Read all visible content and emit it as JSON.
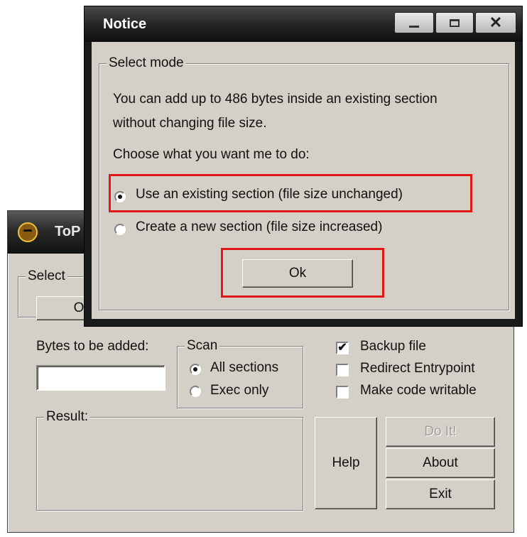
{
  "back_window": {
    "title": "ToP",
    "select_group_label": "Select",
    "open_button_label": "O",
    "bytes_label": "Bytes to be added:",
    "bytes_value": "",
    "scan_group_label": "Scan",
    "scan_options": [
      "All sections",
      "Exec only"
    ],
    "scan_selected": 0,
    "checkboxes": [
      {
        "label": "Backup file",
        "checked": true
      },
      {
        "label": "Redirect Entrypoint",
        "checked": false
      },
      {
        "label": "Make code writable",
        "checked": false
      }
    ],
    "result_label": "Result:",
    "buttons": {
      "help": "Help",
      "do_it": "Do It!",
      "about": "About",
      "exit": "Exit"
    }
  },
  "notice_dialog": {
    "title": "Notice",
    "group_label": "Select mode",
    "message_line1": "You can add up to 486 bytes inside an existing section",
    "message_line2": "without changing file size.",
    "prompt": "Choose what you want me to do:",
    "options": [
      "Use an existing section (file size unchanged)",
      "Create a new section (file size increased)"
    ],
    "selected_option": 0,
    "ok_label": "Ok",
    "caption_buttons": [
      "minimize-icon",
      "maximize-icon",
      "close-icon"
    ]
  },
  "colors": {
    "highlight": "#e01818",
    "face": "#d4d0c8",
    "titlebar": "#1a1a1a"
  }
}
